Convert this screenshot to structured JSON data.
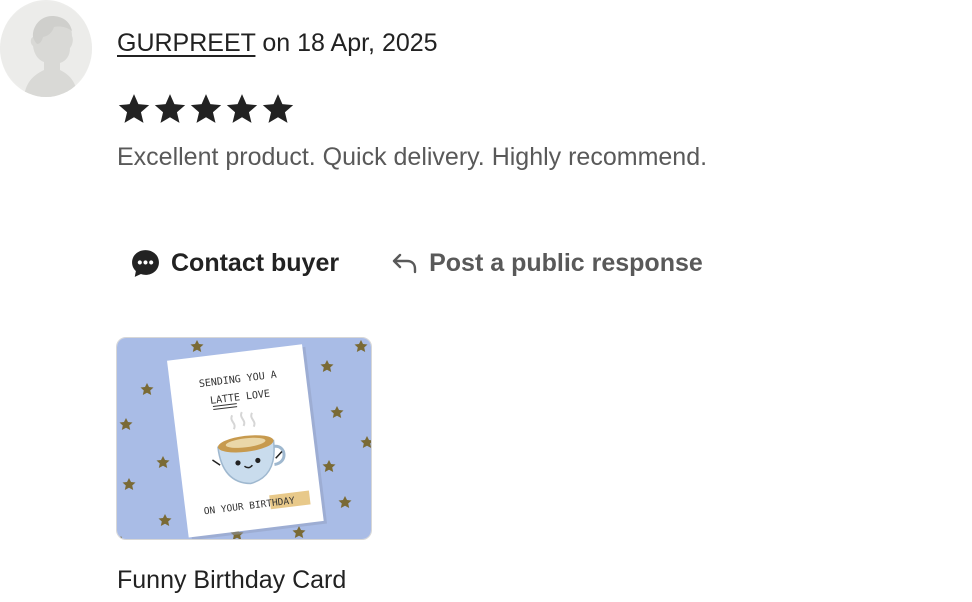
{
  "review": {
    "reviewer_name": "GURPREET",
    "date_text": " on 18 Apr, 2025",
    "rating": 5,
    "rating_max": 5,
    "text": "Excellent product. Quick delivery. Highly recommend."
  },
  "actions": {
    "contact_label": "Contact buyer",
    "contact_icon": "speech-bubble-icon",
    "respond_label": "Post a public response",
    "respond_icon": "reply-arrow-icon"
  },
  "product": {
    "title": "Funny Birthday Card",
    "card_line1": "SENDING YOU A",
    "card_line2a": "LATTE",
    "card_line2b": " LOVE",
    "card_line3a": "ON YOUR ",
    "card_line3b": "BIRTHDAY"
  },
  "colors": {
    "text": "#222222",
    "muted": "#595959",
    "thumb_background": "#a9bce6",
    "highlight": "#e8c98a"
  }
}
